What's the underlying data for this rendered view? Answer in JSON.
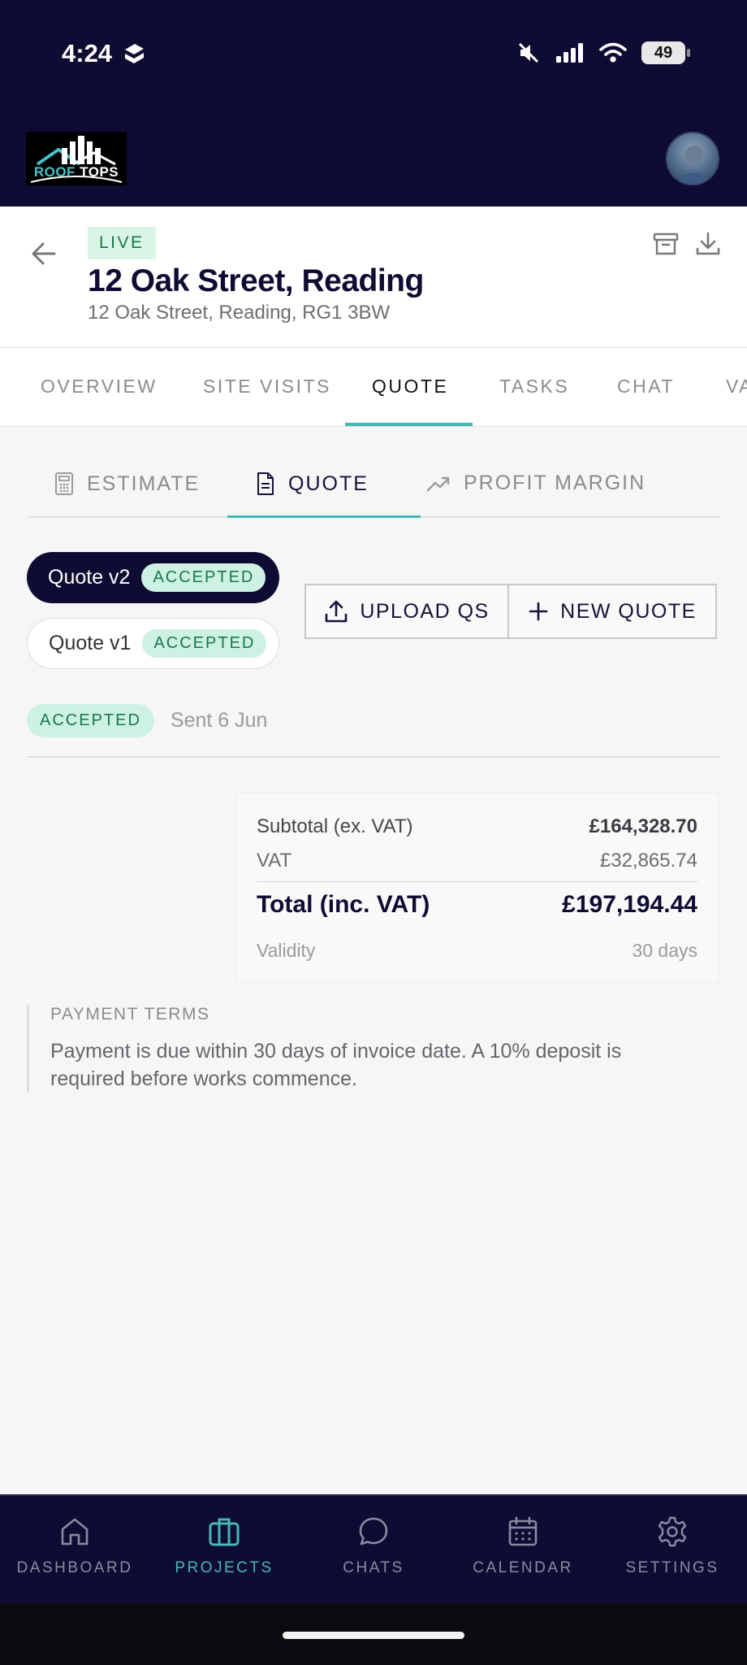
{
  "status_bar": {
    "time": "4:24",
    "battery": "49"
  },
  "header": {
    "logo_text_left": "ROOF",
    "logo_text_right": "TOPS"
  },
  "project": {
    "status": "LIVE",
    "title": "12 Oak Street, Reading",
    "address": "12 Oak Street, Reading, RG1 3BW"
  },
  "main_tabs": [
    {
      "label": "OVERVIEW"
    },
    {
      "label": "SITE VISITS"
    },
    {
      "label": "QUOTE"
    },
    {
      "label": "TASKS"
    },
    {
      "label": "CHAT"
    },
    {
      "label": "VA"
    }
  ],
  "sub_tabs": [
    {
      "label": "ESTIMATE"
    },
    {
      "label": "QUOTE"
    },
    {
      "label": "PROFIT MARGIN"
    }
  ],
  "quotes": [
    {
      "label": "Quote v2",
      "status": "ACCEPTED"
    },
    {
      "label": "Quote v1",
      "status": "ACCEPTED"
    }
  ],
  "actions": {
    "upload": "UPLOAD QS",
    "new_quote": "NEW QUOTE"
  },
  "quote_status": {
    "badge": "ACCEPTED",
    "sent": "Sent 6 Jun"
  },
  "totals": {
    "subtotal_label": "Subtotal (ex. VAT)",
    "subtotal_value": "£164,328.70",
    "vat_label": "VAT",
    "vat_value": "£32,865.74",
    "total_label": "Total (inc. VAT)",
    "total_value": "£197,194.44",
    "validity_label": "Validity",
    "validity_value": "30 days"
  },
  "payment_terms": {
    "title": "PAYMENT TERMS",
    "body": "Payment is due within 30 days of invoice date. A 10% deposit is required before works commence."
  },
  "bottom_nav": [
    {
      "label": "DASHBOARD",
      "icon": "home-icon"
    },
    {
      "label": "PROJECTS",
      "icon": "briefcase-icon"
    },
    {
      "label": "CHATS",
      "icon": "chat-bubble-icon"
    },
    {
      "label": "CALENDAR",
      "icon": "calendar-icon"
    },
    {
      "label": "SETTINGS",
      "icon": "gear-icon"
    }
  ],
  "colors": {
    "navy": "#0f0c33",
    "accent": "#45b7b4",
    "badge_green_bg": "#cdf1e2",
    "badge_green_text": "#17794a"
  }
}
